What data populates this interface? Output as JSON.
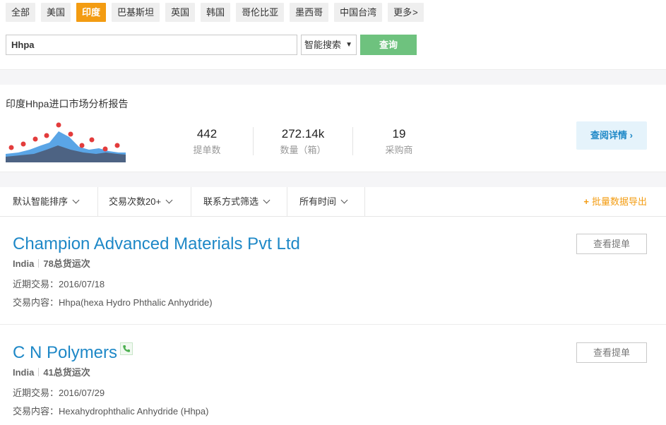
{
  "tabs": [
    {
      "label": "全部",
      "active": false
    },
    {
      "label": "美国",
      "active": false
    },
    {
      "label": "印度",
      "active": true
    },
    {
      "label": "巴基斯坦",
      "active": false
    },
    {
      "label": "英国",
      "active": false
    },
    {
      "label": "韩国",
      "active": false
    },
    {
      "label": "哥伦比亚",
      "active": false
    },
    {
      "label": "墨西哥",
      "active": false
    },
    {
      "label": "中国台湾",
      "active": false
    },
    {
      "label": "更多",
      "active": false
    }
  ],
  "more_chevron": ">",
  "search": {
    "value": "Hhpa",
    "mode": "智能搜索",
    "mode_arrow": "▼",
    "button": "查询"
  },
  "report": {
    "title": "印度Hhpa进口市场分析报告",
    "stats": [
      {
        "value": "442",
        "label": "提单数"
      },
      {
        "value": "272.14k",
        "label": "数量（箱）"
      },
      {
        "value": "19",
        "label": "采购商"
      }
    ],
    "detail_button": "查阅详情 ›"
  },
  "colors": {
    "accent": "#f39c12",
    "link": "#1e88c7",
    "search_button": "#6ec27e"
  },
  "filters": {
    "items": [
      "默认智能排序",
      "交易次数20+",
      "联系方式筛选",
      "所有时间"
    ],
    "export": "批量数据导出",
    "export_icon": "+"
  },
  "results": [
    {
      "name": "Champion Advanced Materials Pvt Ltd",
      "country": "India",
      "shipments": "78总货运次",
      "recent_label": "近期交易：",
      "recent": "2016/07/18",
      "content_label": "交易内容：",
      "content": "Hhpa(hexa Hydro Phthalic Anhydride)",
      "button": "查看提单",
      "has_phone": false
    },
    {
      "name": "C N Polymers",
      "country": "India",
      "shipments": "41总货运次",
      "recent_label": "近期交易：",
      "recent": "2016/07/29",
      "content_label": "交易内容：",
      "content": "Hexahydrophthalic Anhydride (Hhpa)",
      "button": "查看提单",
      "has_phone": true,
      "phone_icon": "phone-icon"
    }
  ]
}
